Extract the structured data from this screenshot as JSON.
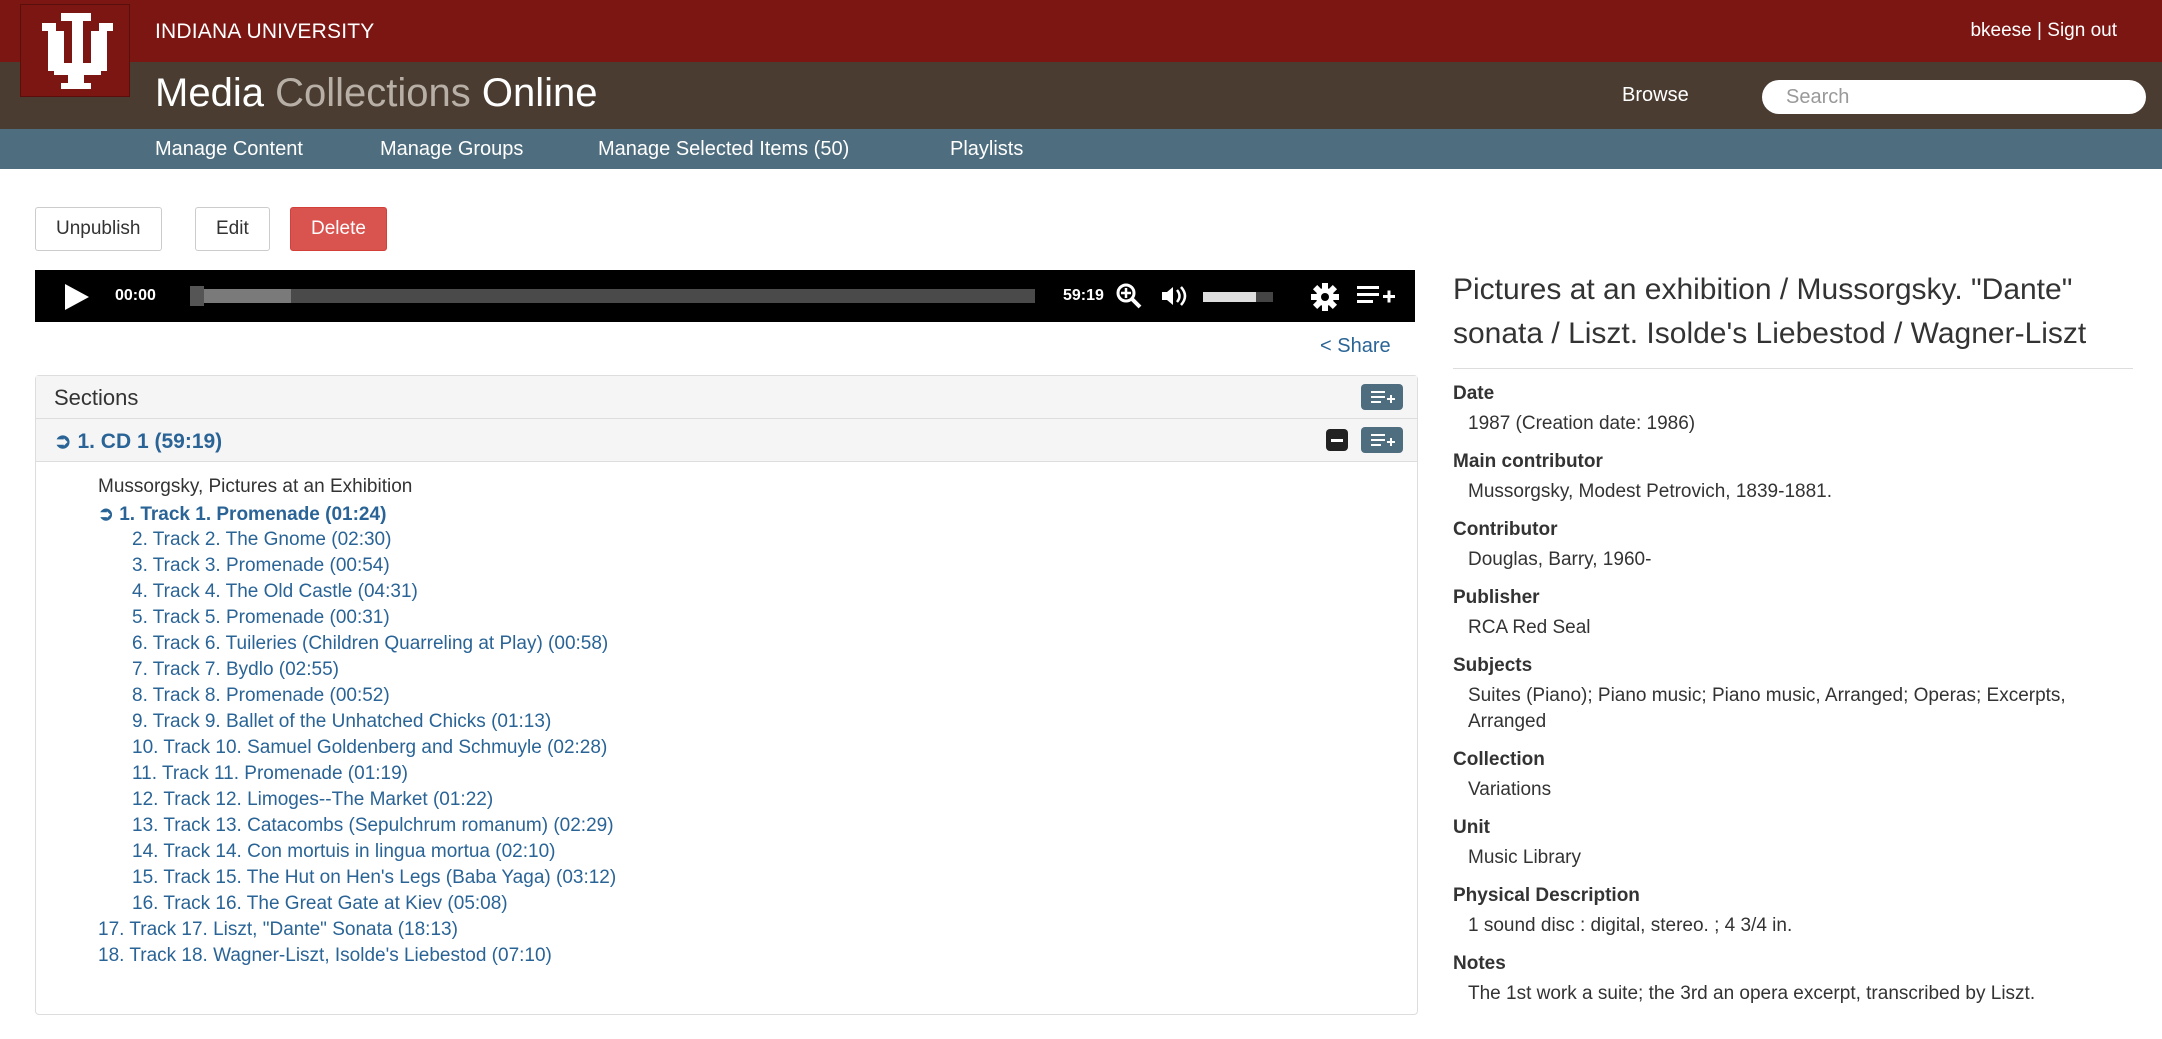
{
  "header": {
    "university": "INDIANA UNIVERSITY",
    "user": "bkeese",
    "sign_out": "Sign out",
    "app_title_part1": "Media",
    "app_title_part2": "Collections",
    "app_title_part3": "Online",
    "browse": "Browse",
    "search_placeholder": "Search"
  },
  "nav": [
    "Manage Content",
    "Manage Groups",
    "Manage Selected Items (50)",
    "Playlists"
  ],
  "actions": {
    "unpublish": "Unpublish",
    "edit": "Edit",
    "delete": "Delete"
  },
  "player": {
    "current_time": "00:00",
    "duration": "59:19",
    "progress": 0.0,
    "buffered": 0.12,
    "volume": 0.75
  },
  "share": "Share",
  "sections": {
    "label": "Sections",
    "section_title": "1. CD 1 (59:19)",
    "group_heading": "Mussorgsky, Pictures at an Exhibition",
    "tracks": [
      "1. Track 1. Promenade (01:24)",
      "2. Track 2. The Gnome (02:30)",
      "3. Track 3. Promenade (00:54)",
      "4. Track 4. The Old Castle (04:31)",
      "5. Track 5. Promenade (00:31)",
      "6. Track 6. Tuileries (Children Quarreling at Play) (00:58)",
      "7. Track 7. Bydlo (02:55)",
      "8. Track 8. Promenade (00:52)",
      "9. Track 9. Ballet of the Unhatched Chicks (01:13)",
      "10. Track 10. Samuel Goldenberg and Schmuyle (02:28)",
      "11. Track 11. Promenade (01:19)",
      "12. Track 12. Limoges--The Market (01:22)",
      "13. Track 13. Catacombs (Sepulchrum romanum) (02:29)",
      "14. Track 14. Con mortuis in lingua mortua (02:10)",
      "15. Track 15. The Hut on Hen's Legs (Baba Yaga) (03:12)",
      "16. Track 16. The Great Gate at Kiev (05:08)",
      "17. Track 17. Liszt, \"Dante\" Sonata (18:13)",
      "18. Track 18. Wagner-Liszt, Isolde's Liebestod (07:10)"
    ]
  },
  "item": {
    "title": "Pictures at an exhibition / Mussorgsky. \"Dante\" sonata / Liszt. Isolde's Liebestod / Wagner-Liszt",
    "fields": [
      {
        "label": "Date",
        "value": "1987 (Creation date: 1986)"
      },
      {
        "label": "Main contributor",
        "value": "Mussorgsky, Modest Petrovich, 1839-1881."
      },
      {
        "label": "Contributor",
        "value": "Douglas, Barry, 1960-"
      },
      {
        "label": "Publisher",
        "value": "RCA Red Seal"
      },
      {
        "label": "Subjects",
        "value": "Suites (Piano); Piano music; Piano music, Arranged; Operas; Excerpts, Arranged"
      },
      {
        "label": "Collection",
        "value": "Variations"
      },
      {
        "label": "Unit",
        "value": "Music Library"
      },
      {
        "label": "Physical Description",
        "value": "1 sound disc : digital, stereo. ; 4 3/4 in."
      },
      {
        "label": "Notes",
        "value": "The 1st work a suite; the 3rd an opera excerpt, transcribed by Liszt."
      }
    ]
  },
  "colors": {
    "iu_red": "#7c1612",
    "brown": "#4a3c31",
    "nav_blue": "#4e6d7e",
    "link": "#2a6496",
    "danger": "#d9534f"
  }
}
